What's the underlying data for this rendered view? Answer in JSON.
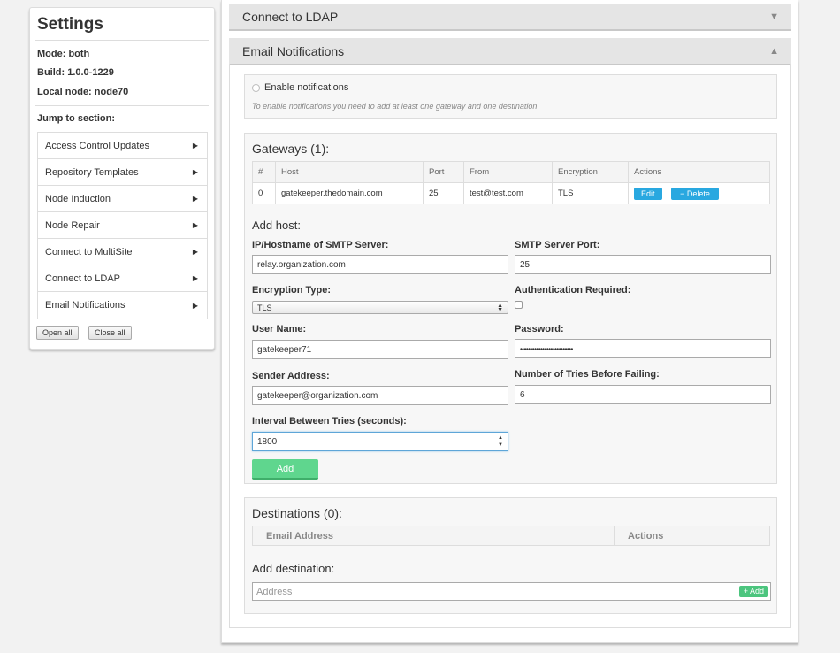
{
  "sidebar": {
    "title": "Settings",
    "mode": "Mode: both",
    "build": "Build: 1.0.0-1229",
    "local_node": "Local node: node70",
    "jump_label": "Jump to section:",
    "items": [
      {
        "label": "Access Control Updates"
      },
      {
        "label": "Repository Templates"
      },
      {
        "label": "Node Induction"
      },
      {
        "label": "Node Repair"
      },
      {
        "label": "Connect to MultiSite"
      },
      {
        "label": "Connect to LDAP"
      },
      {
        "label": "Email Notifications"
      }
    ],
    "open_all": "Open all",
    "close_all": "Close all"
  },
  "accordion": {
    "ldap_title": "Connect to LDAP",
    "email_title": "Email Notifications"
  },
  "notifications": {
    "enable_label": "Enable notifications",
    "hint": "To enable notifications you need to add at least one gateway and one destination"
  },
  "gateways": {
    "title": "Gateways (1):",
    "columns": [
      "#",
      "Host",
      "Port",
      "From",
      "Encryption",
      "Actions"
    ],
    "rows": [
      {
        "num": "0",
        "host": "gatekeeper.thedomain.com",
        "port": "25",
        "from": "test@test.com",
        "encryption": "TLS"
      }
    ],
    "edit_label": "Edit",
    "delete_label": "− Delete"
  },
  "add_host": {
    "title": "Add host:",
    "smtp_server_label": "IP/Hostname of SMTP Server:",
    "smtp_server_value": "relay.organization.com",
    "smtp_port_label": "SMTP Server Port:",
    "smtp_port_value": "25",
    "encryption_label": "Encryption Type:",
    "encryption_value": "TLS",
    "auth_label": "Authentication Required:",
    "username_label": "User Name:",
    "username_value": "gatekeeper71",
    "password_label": "Password:",
    "password_value": "••••••••••••••••••••••••••",
    "sender_label": "Sender Address:",
    "sender_value": "gatekeeper@organization.com",
    "tries_label": "Number of Tries Before Failing:",
    "tries_value": "6",
    "interval_label": "Interval Between Tries (seconds):",
    "interval_value": "1800",
    "add_button": "Add"
  },
  "destinations": {
    "title": "Destinations (0):",
    "col_email": "Email Address",
    "col_actions": "Actions",
    "add_title": "Add destination:",
    "address_placeholder": "Address",
    "add_button": "+ Add"
  },
  "colors": {
    "accent_blue": "#29a8e0",
    "accent_green": "#5fd68e"
  }
}
